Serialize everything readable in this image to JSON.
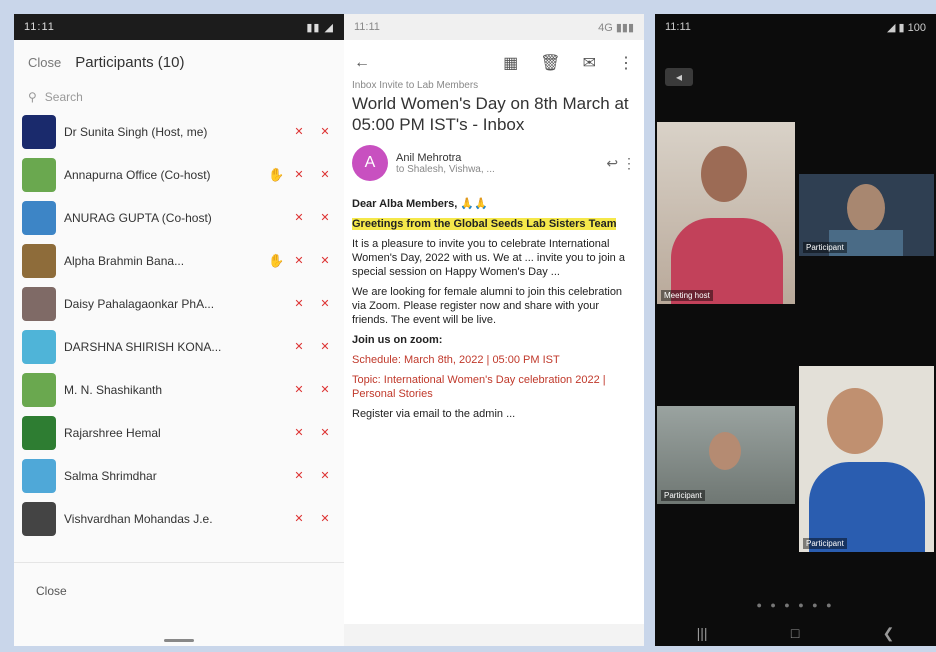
{
  "left": {
    "status_time": "11:11",
    "status_icons": "▮▮ ◢",
    "close_label": "Close",
    "title": "Participants (10)",
    "search_placeholder": "Search",
    "participants": [
      {
        "name": "Dr Sunita Singh (Host, me)",
        "color": "#1a2a6c",
        "hand": "",
        "mic": "✕",
        "cam": "✕"
      },
      {
        "name": "Annapurna Office (Co-host)",
        "color": "#6aa84f",
        "hand": "✋",
        "mic": "✕",
        "cam": "✕"
      },
      {
        "name": "ANURAG GUPTA (Co-host)",
        "color": "#3d85c6",
        "hand": "",
        "mic": "✕",
        "cam": "✕"
      },
      {
        "name": "Alpha Brahmin Bana...",
        "color": "#8e6c3a",
        "hand": "✋",
        "mic": "✕",
        "cam": "✕"
      },
      {
        "name": "Daisy Pahalagaonkar PhA...",
        "color": "#7f6a66",
        "hand": "",
        "mic": "✕",
        "cam": "✕"
      },
      {
        "name": "DARSHNA SHIRISH KONA...",
        "color": "#4fb4d8",
        "hand": "",
        "mic": "✕",
        "cam": "✕"
      },
      {
        "name": "M. N. Shashikanth",
        "color": "#6aa84f",
        "hand": "",
        "mic": "✕",
        "cam": "✕"
      },
      {
        "name": "Rajarshree Hemal",
        "color": "#2e7d32",
        "hand": "",
        "mic": "✕",
        "cam": "✕"
      },
      {
        "name": "Salma Shrimdhar",
        "color": "#4fa8d8",
        "hand": "",
        "mic": "✕",
        "cam": "✕"
      },
      {
        "name": "Vishvardhan Mohandas J.e.",
        "color": "#444",
        "hand": "",
        "mic": "✕",
        "cam": "✕"
      }
    ],
    "footer_label": "Close"
  },
  "mid": {
    "status_time": "11:11",
    "status_right": "4G ▮▮▮",
    "label": "Inbox Invite to Lab Members",
    "subject": "World Women's Day on 8th March at 05:00 PM IST's - Inbox",
    "sender_initial": "A",
    "sender_name": "Anil Mehrotra",
    "sender_to": "to Shalesh, Vishwa, ...",
    "body": {
      "p1": "Dear Alba Members, 🙏🙏",
      "p2": "Greetings from the Global Seeds Lab Sisters Team",
      "p3": "It is a pleasure to invite you to celebrate International Women's Day, 2022 with us. We at ... invite you to join a special session on Happy Women's Day ...",
      "p4": "We are looking for female alumni to join this celebration via Zoom. Please register now and share with your friends. The event will be live.",
      "p5": "Join us on zoom:",
      "p6": "Schedule: March 8th, 2022 | 05:00 PM IST",
      "p7": "Topic: International Women's Day celebration 2022 | Personal Stories",
      "p8": "Register via email to the admin ..."
    }
  },
  "right": {
    "status_time": "11:11",
    "status_right": "◢ ▮ 100",
    "back_label": "◂",
    "tiles": [
      {
        "label": "Meeting host",
        "color": "#6b4a4a"
      },
      {
        "label": "Participant",
        "color": "#4a6b86"
      },
      {
        "label": "Participant",
        "color": "#9aa3a0"
      },
      {
        "label": "Participant",
        "color": "#6d8fb3"
      }
    ],
    "dots": "● ● ● ● ● ●"
  }
}
